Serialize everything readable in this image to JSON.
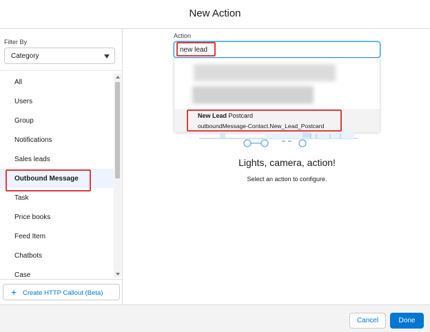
{
  "modal": {
    "title": "New Action"
  },
  "sidebar": {
    "filter_label": "Filter By",
    "filter_value": "Category",
    "categories": [
      {
        "label": "All"
      },
      {
        "label": "Users"
      },
      {
        "label": "Group"
      },
      {
        "label": "Notifications"
      },
      {
        "label": "Sales leads"
      },
      {
        "label": "Outbound Message",
        "selected": true
      },
      {
        "label": "Task"
      },
      {
        "label": "Price books"
      },
      {
        "label": "Feed Item"
      },
      {
        "label": "Chatbots"
      },
      {
        "label": "Case"
      }
    ],
    "http_callout_label": "Create HTTP Callout (Beta)"
  },
  "main": {
    "action_label": "Action",
    "action_value": "new lead",
    "result": {
      "title_bold": "New Lead",
      "title_rest": " Postcard",
      "subtitle": "outboundMessage-Contact.New_Lead_Postcard"
    },
    "empty_title": "Lights, camera, action!",
    "empty_subtitle": "Select an action to configure."
  },
  "footer": {
    "cancel_label": "Cancel",
    "done_label": "Done"
  },
  "colors": {
    "brand": "#0176d3",
    "highlight": "#e03a3e",
    "selected_bg": "#eef4ff"
  }
}
